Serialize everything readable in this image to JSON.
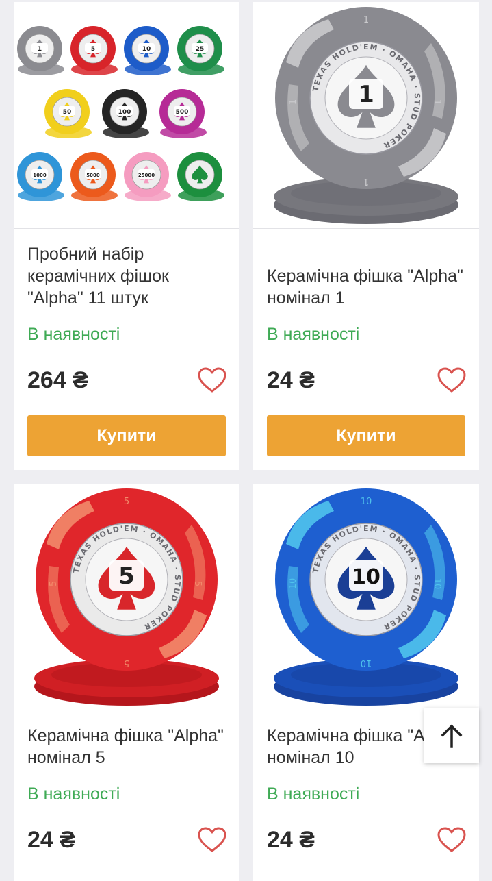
{
  "colors": {
    "background": "#eeeef2",
    "in_stock": "#3faa55",
    "buy_button": "#eda334",
    "heart": "#d9534f"
  },
  "products": [
    {
      "image": "chip-set-eleven",
      "title": "Пробний набір керамічних фішок \"Alpha\" 11 штук",
      "stock": "В наявності",
      "price": "264 ₴",
      "buy_label": "Купити",
      "favorite_icon": "heart-outline-icon"
    },
    {
      "image": "chip-grey-1",
      "chip_value": "1",
      "chip_text": "TEXAS HOLD'EM · OMAHA · STUD POKER",
      "title": "Керамічна фішка \"Alpha\" номінал 1",
      "stock": "В наявності",
      "price": "24 ₴",
      "buy_label": "Купити",
      "favorite_icon": "heart-outline-icon"
    },
    {
      "image": "chip-red-5",
      "chip_value": "5",
      "chip_text": "TEXAS HOLD'EM · OMAHA · STUD POKER",
      "title": "Керамічна фішка \"Alpha\" номінал 5",
      "stock": "В наявності",
      "price": "24 ₴",
      "favorite_icon": "heart-outline-icon"
    },
    {
      "image": "chip-blue-10",
      "chip_value": "10",
      "chip_text": "TEXAS HOLD'EM · OMAHA · STUD POKER",
      "title": "Керамічна фішка \"Alpha\" номінал 10",
      "stock": "В наявності",
      "price": "24 ₴",
      "favorite_icon": "heart-outline-icon"
    }
  ],
  "chip_set_values": [
    "1",
    "5",
    "10",
    "25",
    "50",
    "100",
    "500",
    "1000",
    "5000",
    "25000",
    "",
    ""
  ],
  "scroll_top_icon": "arrow-up-icon"
}
